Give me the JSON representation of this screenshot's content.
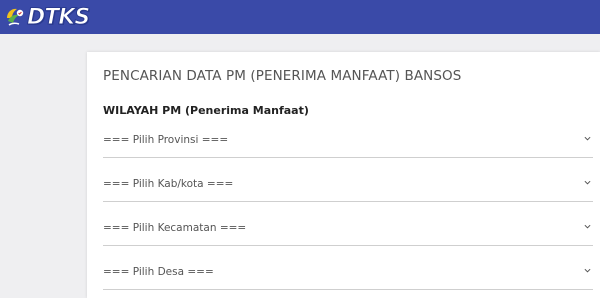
{
  "header": {
    "logo_text": "DTKS",
    "accent_color": "#3a4aa8"
  },
  "main": {
    "page_title": "PENCARIAN DATA PM (PENERIMA MANFAAT) BANSOS",
    "section_title": "WILAYAH PM (Penerima Manfaat)",
    "selects": [
      {
        "selected": "=== Pilih Provinsi ===",
        "icon": "chevron-down-icon"
      },
      {
        "selected": "=== Pilih Kab/kota ===",
        "icon": "chevron-down-icon"
      },
      {
        "selected": "=== Pilih Kecamatan ===",
        "icon": "chevron-down-icon"
      },
      {
        "selected": "=== Pilih Desa ===",
        "icon": "chevron-down-icon"
      }
    ]
  }
}
